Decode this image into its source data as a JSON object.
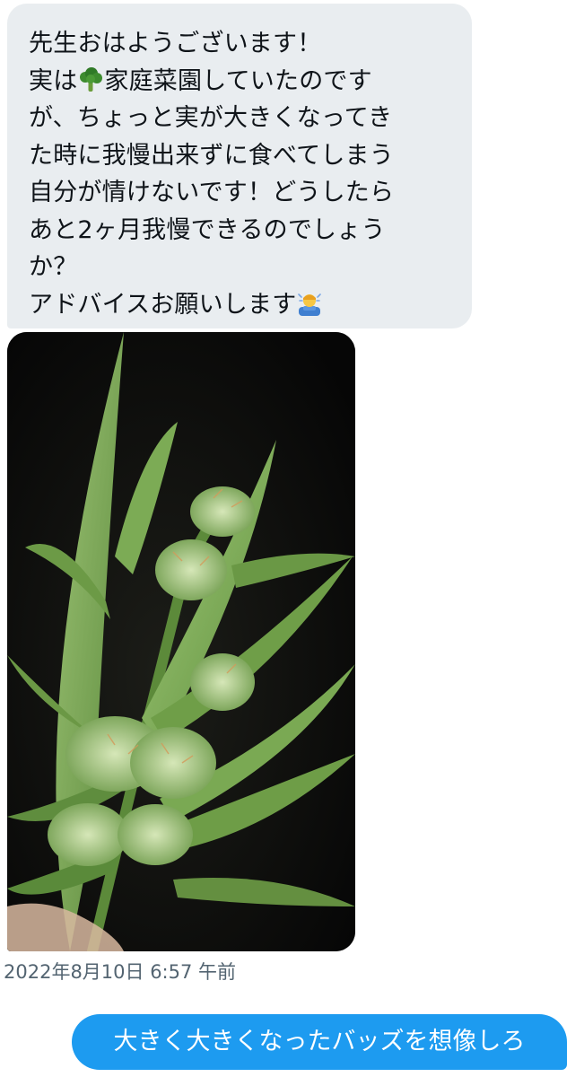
{
  "conversation": {
    "received_message": {
      "lines": [
        "先生おはようございます！",
        "家庭菜園していたのです",
        "が、ちょっと実が大きくなってき",
        "た時に我慢出来ずに食べてしまう",
        "自分が情けないです！どうしたら",
        "あと2ヶ月我慢できるのでしょう",
        "か？",
        "アドバイスお願いします"
      ],
      "line2_prefix": "実は",
      "emoji_1": "broccoli-icon",
      "emoji_2": "person-bowing-icon",
      "attachment": {
        "type": "photo",
        "subject": "cannabis-plant-photo"
      }
    },
    "timestamp": "2022年8月10日 6:57 午前",
    "sent_message": {
      "text": "大きく大きくなったバッズを想像しろ"
    }
  },
  "colors": {
    "received_bubble": "#e9edf0",
    "sent_bubble": "#1d9bf0",
    "text_primary": "#0f1419",
    "text_secondary": "#536471",
    "photo_background": "#0c0c0c",
    "leaf_green": "#7fae5a"
  }
}
